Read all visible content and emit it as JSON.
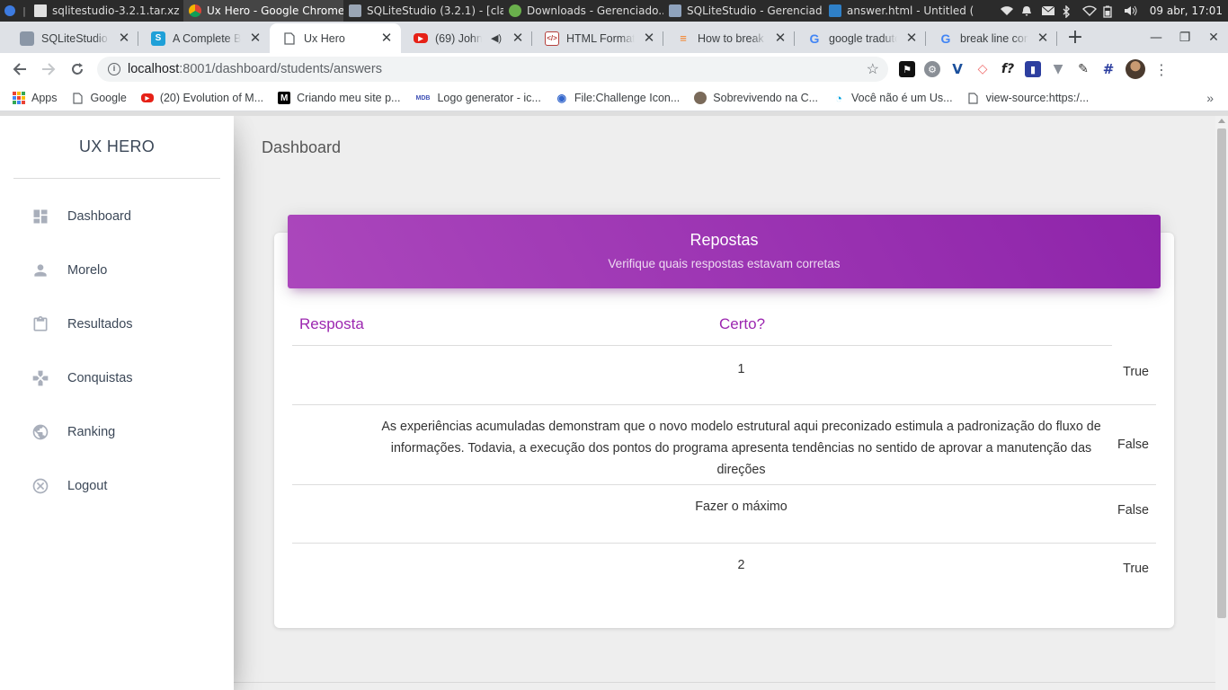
{
  "taskbar": {
    "tasks": [
      {
        "label": "sqlitestudio-3.2.1.tar.xz",
        "icon": "archive-icon"
      },
      {
        "label": "Ux Hero - Google Chrome",
        "icon": "chrome-icon"
      },
      {
        "label": "SQLiteStudio (3.2.1) - [cla...",
        "icon": "sqlitestudio-icon"
      },
      {
        "label": "Downloads - Gerenciado...",
        "icon": "download-icon"
      },
      {
        "label": "SQLiteStudio - Gerenciad...",
        "icon": "folder-icon"
      },
      {
        "label": "answer.html - Untitled (...",
        "icon": "vscode-icon"
      }
    ],
    "clock": "09 abr, 17:01"
  },
  "browser": {
    "tabs": [
      {
        "title": "SQLiteStudio - ",
        "favicon": "sqlitestudio-icon"
      },
      {
        "title": "A Complete Be",
        "favicon": "s-icon"
      },
      {
        "title": "Ux Hero",
        "favicon": "page-icon"
      },
      {
        "title": "(69) John N",
        "favicon": "youtube-icon"
      },
      {
        "title": "HTML Formatt",
        "favicon": "formatter-icon"
      },
      {
        "title": "How to break a",
        "favicon": "stackoverflow-icon"
      },
      {
        "title": "google traduto",
        "favicon": "google-icon"
      },
      {
        "title": "break line cont",
        "favicon": "google-icon"
      }
    ],
    "url_host": "localhost",
    "url_path": ":8001/dashboard/students/answers",
    "bookmarks": [
      {
        "label": "Apps",
        "icon": "apps-icon"
      },
      {
        "label": "Google",
        "icon": "page-icon"
      },
      {
        "label": "(20) Evolution of M...",
        "icon": "youtube-icon"
      },
      {
        "label": "Criando meu site p...",
        "icon": "medium-icon"
      },
      {
        "label": "Logo generator - ic...",
        "icon": "mdb-icon"
      },
      {
        "label": "File:Challenge Icon...",
        "icon": "wikimedia-icon"
      },
      {
        "label": "Sobrevivendo na C...",
        "icon": "avatar-icon"
      },
      {
        "label": "Você não é um Us...",
        "icon": "ubuntu-icon"
      },
      {
        "label": "view-source:https:/...",
        "icon": "page-icon"
      }
    ]
  },
  "sidebar": {
    "brand": "UX HERO",
    "items": [
      {
        "label": "Dashboard",
        "icon": "dashboard-icon"
      },
      {
        "label": "Morelo",
        "icon": "person-icon"
      },
      {
        "label": "Resultados",
        "icon": "clipboard-icon"
      },
      {
        "label": "Conquistas",
        "icon": "gamepad-icon"
      },
      {
        "label": "Ranking",
        "icon": "globe-icon"
      },
      {
        "label": "Logout",
        "icon": "cancel-icon"
      }
    ]
  },
  "main": {
    "title": "Dashboard",
    "card": {
      "title": "Repostas",
      "subtitle": "Verifique quais respostas estavam corretas"
    },
    "table": {
      "headers": [
        "Resposta",
        "Certo?"
      ],
      "rows": [
        {
          "answer": "1",
          "correct": "True"
        },
        {
          "answer": "As experiências acumuladas demonstram que o novo modelo estrutural aqui preconizado estimula a padronização do fluxo de informações. Todavia, a execução dos pontos do programa apresenta tendências no sentido de aprovar a manutenção das direções",
          "correct": "False"
        },
        {
          "answer": "Fazer o máximo",
          "correct": "False"
        },
        {
          "answer": "2",
          "correct": "True"
        }
      ]
    }
  },
  "colors": {
    "accent": "#9c27b0",
    "header_gradient_start": "#ab47bc",
    "header_gradient_end": "#8e24aa"
  }
}
